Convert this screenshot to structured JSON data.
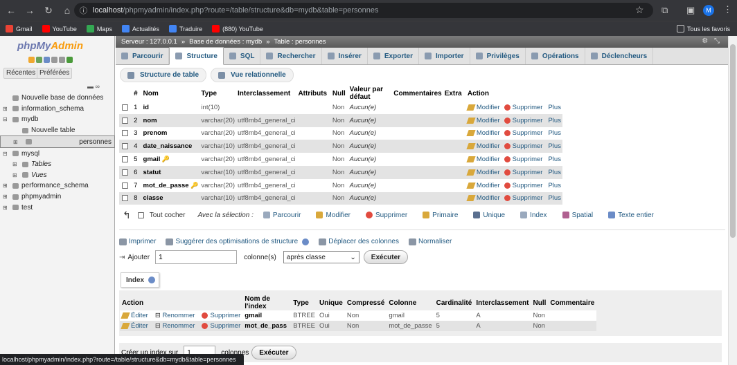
{
  "browser": {
    "url_host": "localhost",
    "url_path": "/phpmyadmin/index.php?route=/table/structure&db=mydb&table=personnes",
    "avatar_letter": "M",
    "bookmarks": [
      {
        "label": "Gmail",
        "color": "#ea4335"
      },
      {
        "label": "YouTube",
        "color": "#ff0000"
      },
      {
        "label": "Maps",
        "color": "#34a853"
      },
      {
        "label": "Actualités",
        "color": "#4285f4"
      },
      {
        "label": "Traduire",
        "color": "#4285f4"
      },
      {
        "label": "(880) YouTube",
        "color": "#ff0000"
      }
    ],
    "all_bookmarks": "Tous les favoris",
    "status_url": "localhost/phpmyadmin/index.php?route=/table/structure&db=mydb&table=personnes"
  },
  "sidebar": {
    "logo_php": "php",
    "logo_my": "My",
    "logo_admin": "Admin",
    "tab_recent": "Récentes",
    "tab_favorites": "Préférées",
    "tree": [
      {
        "label": "Nouvelle base de données",
        "level": 0,
        "expander": "",
        "selected": false
      },
      {
        "label": "information_schema",
        "level": 0,
        "expander": "+",
        "selected": false
      },
      {
        "label": "mydb",
        "level": 0,
        "expander": "−",
        "selected": false
      },
      {
        "label": "Nouvelle table",
        "level": 1,
        "expander": "",
        "selected": false
      },
      {
        "label": "personnes",
        "level": 1,
        "expander": "+",
        "selected": true
      },
      {
        "label": "mysql",
        "level": 0,
        "expander": "−",
        "selected": false
      },
      {
        "label": "Tables",
        "level": 1,
        "expander": "+",
        "selected": false,
        "italic": true
      },
      {
        "label": "Vues",
        "level": 1,
        "expander": "+",
        "selected": false,
        "italic": true
      },
      {
        "label": "performance_schema",
        "level": 0,
        "expander": "+",
        "selected": false
      },
      {
        "label": "phpmyadmin",
        "level": 0,
        "expander": "+",
        "selected": false
      },
      {
        "label": "test",
        "level": 0,
        "expander": "+",
        "selected": false
      }
    ]
  },
  "breadcrumb": {
    "server": "Serveur : 127.0.0.1",
    "database": "Base de données : mydb",
    "table": "Table : personnes"
  },
  "tabs": [
    "Parcourir",
    "Structure",
    "SQL",
    "Rechercher",
    "Insérer",
    "Exporter",
    "Importer",
    "Privilèges",
    "Opérations",
    "Déclencheurs"
  ],
  "subtabs": [
    "Structure de table",
    "Vue relationnelle"
  ],
  "structure": {
    "headers": [
      "#",
      "Nom",
      "Type",
      "Interclassement",
      "Attributs",
      "Null",
      "Valeur par défaut",
      "Commentaires",
      "Extra",
      "Action"
    ],
    "rows": [
      {
        "num": "1",
        "name": "id",
        "type": "int(10)",
        "collation": "",
        "null": "Non",
        "default": "Aucun(e)",
        "key": false
      },
      {
        "num": "2",
        "name": "nom",
        "type": "varchar(20)",
        "collation": "utf8mb4_general_ci",
        "null": "Non",
        "default": "Aucun(e)",
        "key": false
      },
      {
        "num": "3",
        "name": "prenom",
        "type": "varchar(20)",
        "collation": "utf8mb4_general_ci",
        "null": "Non",
        "default": "Aucun(e)",
        "key": false
      },
      {
        "num": "4",
        "name": "date_naissance",
        "type": "varchar(10)",
        "collation": "utf8mb4_general_ci",
        "null": "Non",
        "default": "Aucun(e)",
        "key": false
      },
      {
        "num": "5",
        "name": "gmail",
        "type": "varchar(20)",
        "collation": "utf8mb4_general_ci",
        "null": "Non",
        "default": "Aucun(e)",
        "key": true
      },
      {
        "num": "6",
        "name": "statut",
        "type": "varchar(10)",
        "collation": "utf8mb4_general_ci",
        "null": "Non",
        "default": "Aucun(e)",
        "key": false
      },
      {
        "num": "7",
        "name": "mot_de_passe",
        "type": "varchar(20)",
        "collation": "utf8mb4_general_ci",
        "null": "Non",
        "default": "Aucun(e)",
        "key": true
      },
      {
        "num": "8",
        "name": "classe",
        "type": "varchar(10)",
        "collation": "utf8mb4_general_ci",
        "null": "Non",
        "default": "Aucun(e)",
        "key": false
      }
    ],
    "action_modify": "Modifier",
    "action_delete": "Supprimer",
    "action_more": "Plus"
  },
  "selection": {
    "check_all": "Tout cocher",
    "with_selection": "Avec la sélection :",
    "actions": [
      "Parcourir",
      "Modifier",
      "Supprimer",
      "Primaire",
      "Unique",
      "Index",
      "Spatial",
      "Texte entier"
    ]
  },
  "tools": [
    "Imprimer",
    "Suggérer des optimisations de structure",
    "Déplacer des colonnes",
    "Normaliser"
  ],
  "add_columns": {
    "label": "Ajouter",
    "count": "1",
    "unit": "colonne(s)",
    "position": "après classe",
    "execute": "Exécuter"
  },
  "indexes": {
    "title": "Index",
    "headers": [
      "Action",
      "Nom de l'index",
      "Type",
      "Unique",
      "Compressé",
      "Colonne",
      "Cardinalité",
      "Interclassement",
      "Null",
      "Commentaire"
    ],
    "rows": [
      {
        "name": "gmail",
        "type": "BTREE",
        "unique": "Oui",
        "packed": "Non",
        "column": "gmail",
        "cardinality": "5",
        "collation": "A",
        "null": "Non",
        "comment": ""
      },
      {
        "name": "mot_de_pass",
        "type": "BTREE",
        "unique": "Oui",
        "packed": "Non",
        "column": "mot_de_passe",
        "cardinality": "5",
        "collation": "A",
        "null": "Non",
        "comment": ""
      }
    ],
    "edit": "Éditer",
    "rename": "Renommer",
    "delete": "Supprimer"
  },
  "create_index": {
    "label": "Créer un index sur",
    "count": "1",
    "unit": "colonnes",
    "execute": "Exécuter"
  }
}
